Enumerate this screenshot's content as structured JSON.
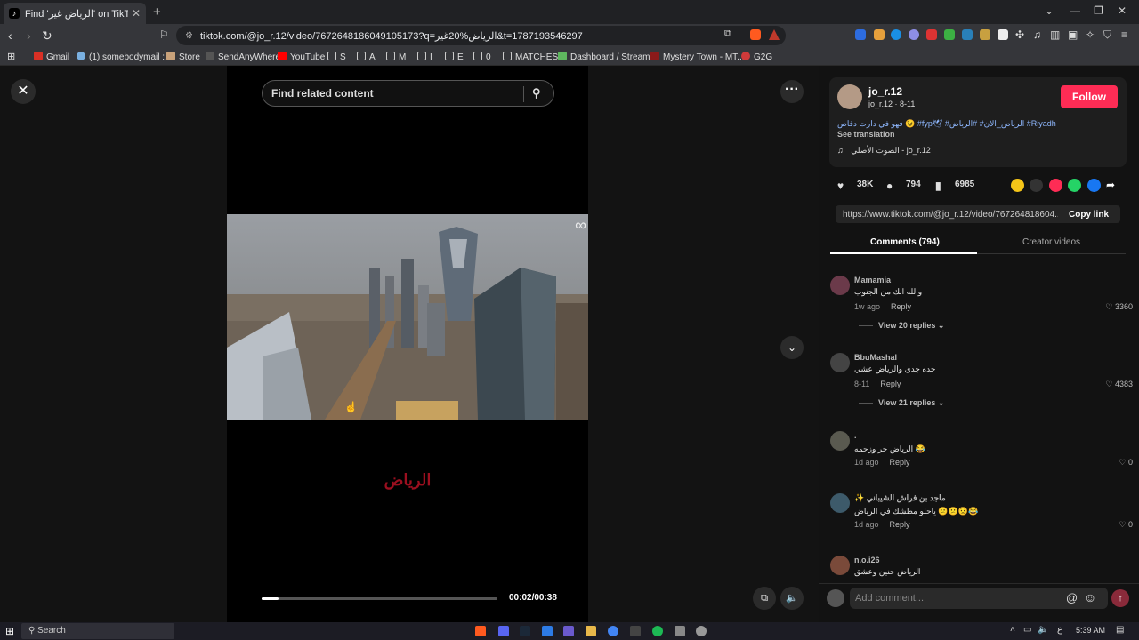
{
  "browser": {
    "tab_title": "Find 'الرياض غير' on TikTok | T",
    "tab_close": "✕",
    "new_tab": "+",
    "url": "tiktok.com/@jo_r.12/video/7672648186049105173?q=الرياض%20غير&t=1787193546297",
    "bookmarks": [
      {
        "label": "Gmail"
      },
      {
        "label": "(1) somebodymail :..."
      },
      {
        "label": "Store"
      },
      {
        "label": "SendAnyWhere"
      },
      {
        "label": "YouTube"
      },
      {
        "label": "S"
      },
      {
        "label": "A"
      },
      {
        "label": "M"
      },
      {
        "label": "I"
      },
      {
        "label": "E"
      },
      {
        "label": "0"
      },
      {
        "label": "MATCHES"
      },
      {
        "label": "Dashboard / Stream..."
      },
      {
        "label": "Mystery Town - MT..."
      },
      {
        "label": "G2G"
      }
    ]
  },
  "video": {
    "search_placeholder": "Find related content",
    "caption": "الرياض",
    "time": "00:02/00:38",
    "progress": 0.07
  },
  "creator": {
    "username": "jo_r.12",
    "subline": "jo_r.12 · 8-11",
    "follow_label": "Follow",
    "description": "فهو في دارت دقاص 😉 #fyp🕊 #الرياض_الان# #الرياض #Riyadh",
    "see_translation": "See translation",
    "music": "الصوت الأصلي - jo_r.12",
    "music_icon": "♫"
  },
  "stats": {
    "likes": "38K",
    "comments": "794",
    "saves": "6985"
  },
  "share": {
    "link": "https://www.tiktok.com/@jo_r.12/video/767264818604...",
    "copy_label": "Copy link"
  },
  "tabs": {
    "comments": "Comments (794)",
    "creator_videos": "Creator videos"
  },
  "comments": [
    {
      "name": "Mamamia",
      "text": "والله انك من الجنوب",
      "time": "1w ago",
      "reply": "Reply",
      "likes": "3360",
      "view_replies": "View 20 replies ⌄"
    },
    {
      "name": "BbuMashal",
      "text": "جده جدي والرياض عشي",
      "time": "8-11",
      "reply": "Reply",
      "likes": "4383",
      "view_replies": "View 21 replies ⌄"
    },
    {
      "name": ".",
      "text": "الرياض حر وزحمه 😂",
      "time": "1d ago",
      "reply": "Reply",
      "likes": "0"
    },
    {
      "name": "✨ ماجد بن فراش الشيباني",
      "text": "ياحلو مطشك في الرياض 😕😕😟😂",
      "time": "1d ago",
      "reply": "Reply",
      "likes": "0"
    },
    {
      "name": "n.o.i26",
      "text": "الرياض حنين وعشق"
    }
  ],
  "comment_input": {
    "placeholder": "Add comment..."
  },
  "taskbar": {
    "search": "Search",
    "time": "5:39 AM",
    "lang": "ع"
  },
  "colors": {
    "follow": "#fe2c55",
    "caption": "#9b0f1f",
    "hashtag": "#8fb8ff"
  }
}
